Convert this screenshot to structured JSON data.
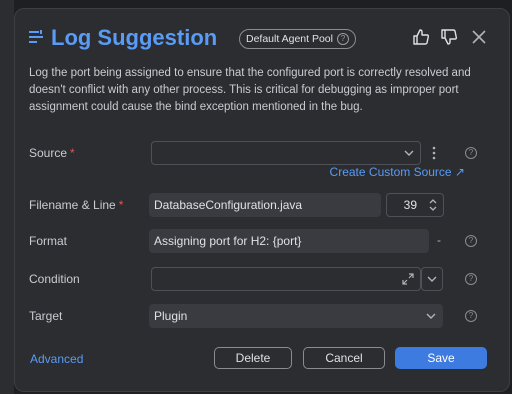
{
  "header": {
    "title": "Log Suggestion",
    "pool_badge": "Default Agent Pool"
  },
  "description": "Log the port being assigned to ensure that the configured port is correctly resolved and doesn't conflict with any other process. This is critical for debugging as improper port assignment could cause the bind exception mentioned in the bug.",
  "form": {
    "source": {
      "label": "Source",
      "required_mark": "*",
      "value": ""
    },
    "create_source_link": "Create Custom Source ↗",
    "filename": {
      "label": "Filename & Line",
      "required_mark": "*",
      "value": "DatabaseConfiguration.java",
      "line": "39"
    },
    "format": {
      "label": "Format",
      "value": "Assigning port for H2: {port}",
      "dash": "-"
    },
    "condition": {
      "label": "Condition",
      "value": ""
    },
    "target": {
      "label": "Target",
      "value": "Plugin"
    }
  },
  "footer": {
    "advanced_label": "Advanced",
    "delete_label": "Delete",
    "cancel_label": "Cancel",
    "save_label": "Save"
  },
  "colors": {
    "accent": "#5a9bf6",
    "primary_button": "#3d7be0",
    "required": "#e5554f",
    "background": "#2b2d30"
  },
  "icons": [
    "filter-lines-icon",
    "thumbs-up-icon",
    "thumbs-down-icon",
    "close-icon",
    "chevron-down-icon",
    "kebab-menu-icon",
    "expand-icon",
    "help-icon",
    "stepper-icon"
  ]
}
